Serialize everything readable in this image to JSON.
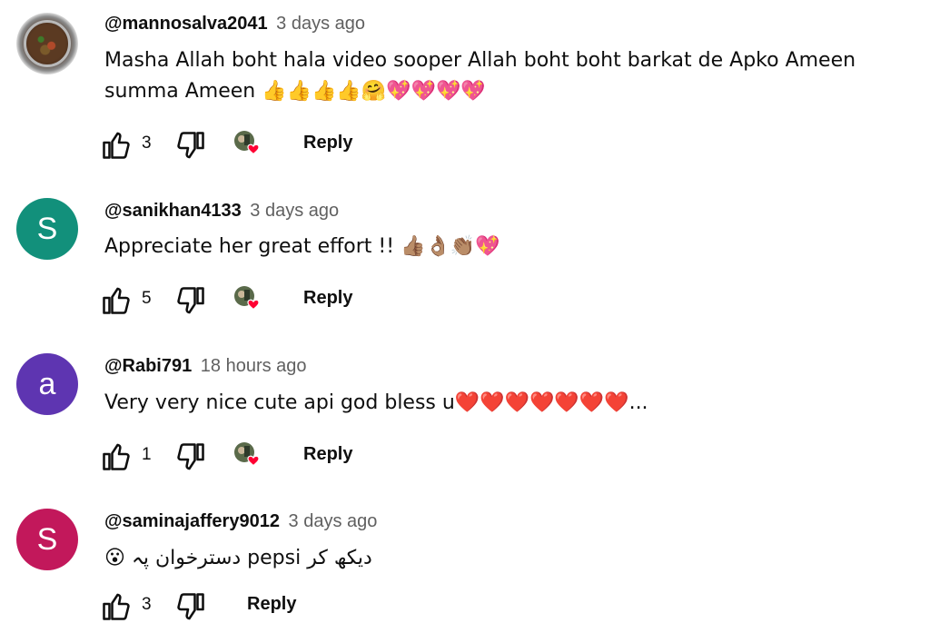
{
  "comments": [
    {
      "author": "@mannosalva2041",
      "time": "3 days ago",
      "text": "Masha Allah boht hala  video sooper Allah boht boht barkat de Apko Ameen summa Ameen 👍👍👍👍🤗💖💖💖💖",
      "likes": "3",
      "reply_label": "Reply",
      "avatar": {
        "type": "photo"
      },
      "creator_heart": true
    },
    {
      "author": "@sanikhan4133",
      "time": "3 days ago",
      "text": "Appreciate her great effort !! 👍🏽👌🏽👏🏽💖",
      "likes": "5",
      "reply_label": "Reply",
      "avatar": {
        "type": "letter",
        "letter": "S",
        "color": "#12907b"
      },
      "creator_heart": true
    },
    {
      "author": "@Rabi791",
      "time": "18 hours ago",
      "text": "Very very nice cute api god bless u❤️❤️❤️❤️❤️❤️❤️...",
      "likes": "1",
      "reply_label": "Reply",
      "avatar": {
        "type": "letter",
        "letter": "a",
        "color": "#5e35b1"
      },
      "creator_heart": true
    },
    {
      "author": "@saminajaffery9012",
      "time": "3 days ago",
      "text": "😮 دسترخوان پہ pepsi دیکھ کر",
      "likes": "3",
      "reply_label": "Reply",
      "avatar": {
        "type": "letter",
        "letter": "S",
        "color": "#c2185b"
      },
      "creator_heart": false
    }
  ],
  "icons": {
    "like": "thumb-up-icon",
    "dislike": "thumb-down-icon",
    "creator_heart": "creator-heart-icon"
  },
  "colors": {
    "heart": "#ff0033",
    "secondary_text": "#606060"
  }
}
